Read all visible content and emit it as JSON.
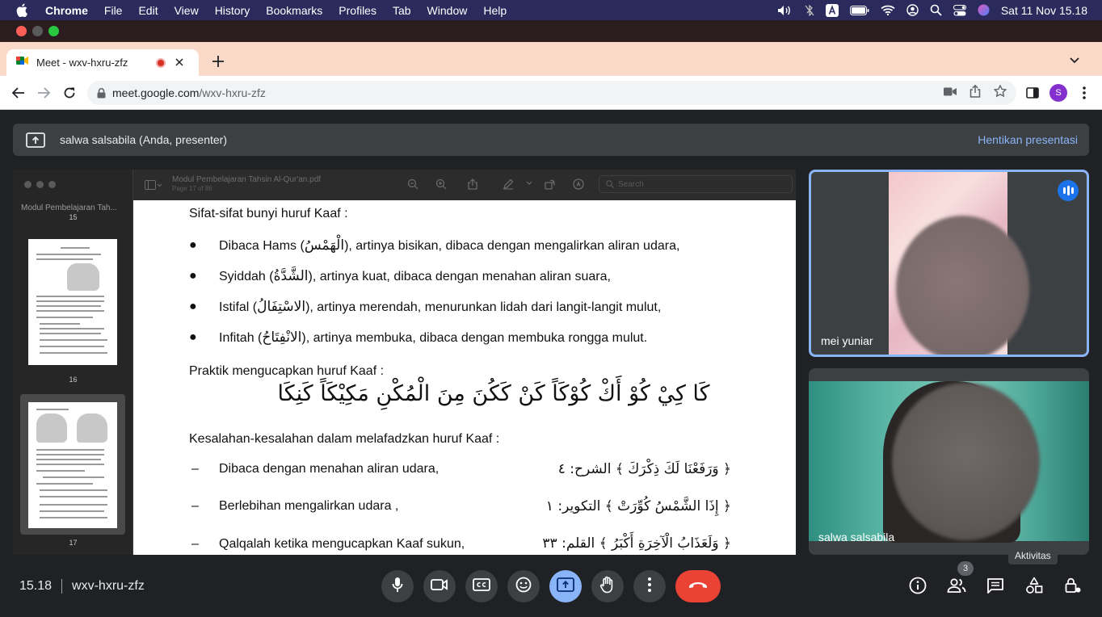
{
  "menubar": {
    "app_name": "Chrome",
    "items": [
      "File",
      "Edit",
      "View",
      "History",
      "Bookmarks",
      "Profiles",
      "Tab",
      "Window",
      "Help"
    ],
    "clock": "Sat 11 Nov  15.18"
  },
  "browser": {
    "tab_title": "Meet - wxv-hxru-zfz",
    "url_host": "meet.google.com",
    "url_path": "/wxv-hxru-zfz",
    "profile_initial": "S"
  },
  "meet": {
    "presenter_label": "salwa salsabila (Anda, presenter)",
    "stop_presenting": "Hentikan presentasi",
    "time": "15.18",
    "meeting_code": "wxv-hxru-zfz",
    "participant_count": "3",
    "activities_tooltip": "Aktivitas",
    "participants": [
      {
        "name": "mei yuniar"
      },
      {
        "name": "salwa salsabila"
      }
    ]
  },
  "viewer": {
    "doc_title": "Modul Pembelajaran Tahsin Al-Qur'an.pdf",
    "doc_page": "Page 17 of 86",
    "sidebar_title": "Modul Pembelajaran Tah...",
    "thumb_prev_num": "15",
    "thumbs": [
      "16",
      "17"
    ],
    "search_placeholder": "Search"
  },
  "document": {
    "heading1": "Sifat-sifat bunyi huruf Kaaf :",
    "bullets": [
      {
        "pre": "Dibaca Hams (",
        "ar": "الْهَمْسُ",
        "post": "), artinya bisikan, dibaca dengan mengalirkan aliran udara,"
      },
      {
        "pre": "Syiddah (",
        "ar": "الشَّدَّةُ",
        "post": "), artinya kuat, dibaca dengan menahan aliran suara,"
      },
      {
        "pre": "Istifal (",
        "ar": "الاسْتِفَالُ",
        "post": "), artinya merendah, menurunkan lidah dari langit-langit mulut,"
      },
      {
        "pre": "Infitah (",
        "ar": "الانْفِتَاحُ",
        "post": "), artinya membuka, dibaca dengan membuka rongga mulut."
      }
    ],
    "heading2": "Praktik mengucapkan huruf Kaaf :",
    "practice_arabic": "كَا كِيْ كُوْ أَكْ   كُوْكَاً كَنْ كَكُنَ   مِنَ الْمُكْنِ   مَكِيْكَاً كَنِكَا",
    "heading3": "Kesalahan-kesalahan dalam melafadzkan huruf Kaaf :",
    "mistakes": [
      {
        "text": "Dibaca dengan menahan aliran udara,",
        "ar": "﴿ وَرَفَعْنَا لَكَ ذِكْرَكَ ﴾ الشرح: ٤"
      },
      {
        "text": "Berlebihan mengalirkan udara ,",
        "ar": "﴿ إِذَا الشَّمْسُ كُوِّرَتْ ﴾ التكوير: ١"
      },
      {
        "text": "Qalqalah ketika mengucapkan Kaaf sukun,",
        "ar": "﴿ وَلَعَذَابُ الْآخِرَةِ أَكْبَرُ ﴾ القلم: ٣٣"
      }
    ]
  }
}
